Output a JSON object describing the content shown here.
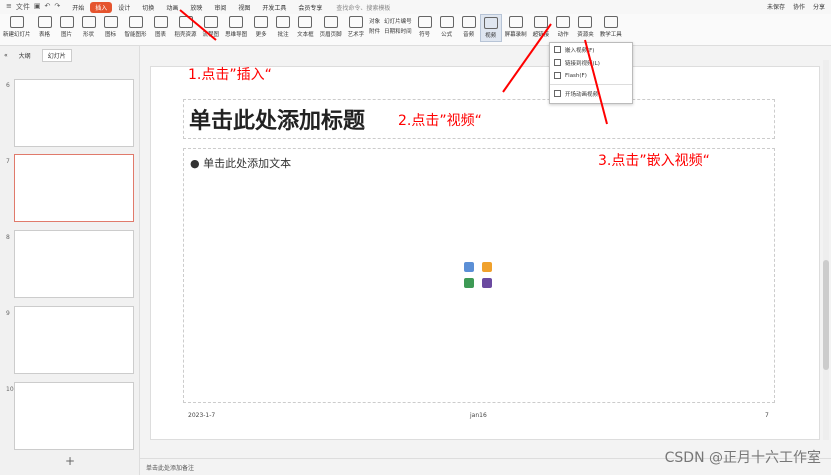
{
  "menubar": {
    "file": "文件",
    "menus": [
      "开始",
      "插入",
      "设计",
      "切换",
      "动画",
      "放映",
      "审阅",
      "视图",
      "开发工具",
      "会员专享"
    ],
    "active": "插入",
    "search": "查找命令、搜索模板",
    "right": [
      "未保存",
      "协作",
      "分享"
    ]
  },
  "ribbon": {
    "buttons": [
      "新建幻灯片",
      "表格",
      "图片",
      "形状",
      "图标",
      "智能图形",
      "图表",
      "稻壳资源",
      "流程图",
      "思维导图",
      "更多",
      "批注",
      "文本框",
      "页眉页脚",
      "艺术字"
    ],
    "smalls": [
      "对象",
      "幻灯片编号",
      "附件",
      "日期和时间"
    ],
    "symbol": "符号",
    "formula": "公式",
    "audio": "音频",
    "video": "视频",
    "screen": "屏幕录制",
    "link": "超链接",
    "action": "动作",
    "resource": "资源夹",
    "teaching": "教学工具"
  },
  "dropdown": {
    "items": [
      "嵌入视频(F)",
      "链接到视频(L)",
      "Flash(F)",
      "开场动画视频"
    ]
  },
  "leftpanel": {
    "tabs": [
      "大纲",
      "幻灯片"
    ],
    "slides": [
      "6",
      "7",
      "8",
      "9",
      "10"
    ],
    "add": "+"
  },
  "slide": {
    "title": "单击此处添加标题",
    "body": "单击此处添加文本",
    "date": "2023-1-7",
    "footer": "jan16",
    "page": "7"
  },
  "notes": "单击此处添加备注",
  "annotations": {
    "step1": "1.点击”插入“",
    "step2": "2.点击”视频“",
    "step3": "3.点击”嵌入视频“"
  },
  "watermark": "CSDN @正月十六工作室"
}
